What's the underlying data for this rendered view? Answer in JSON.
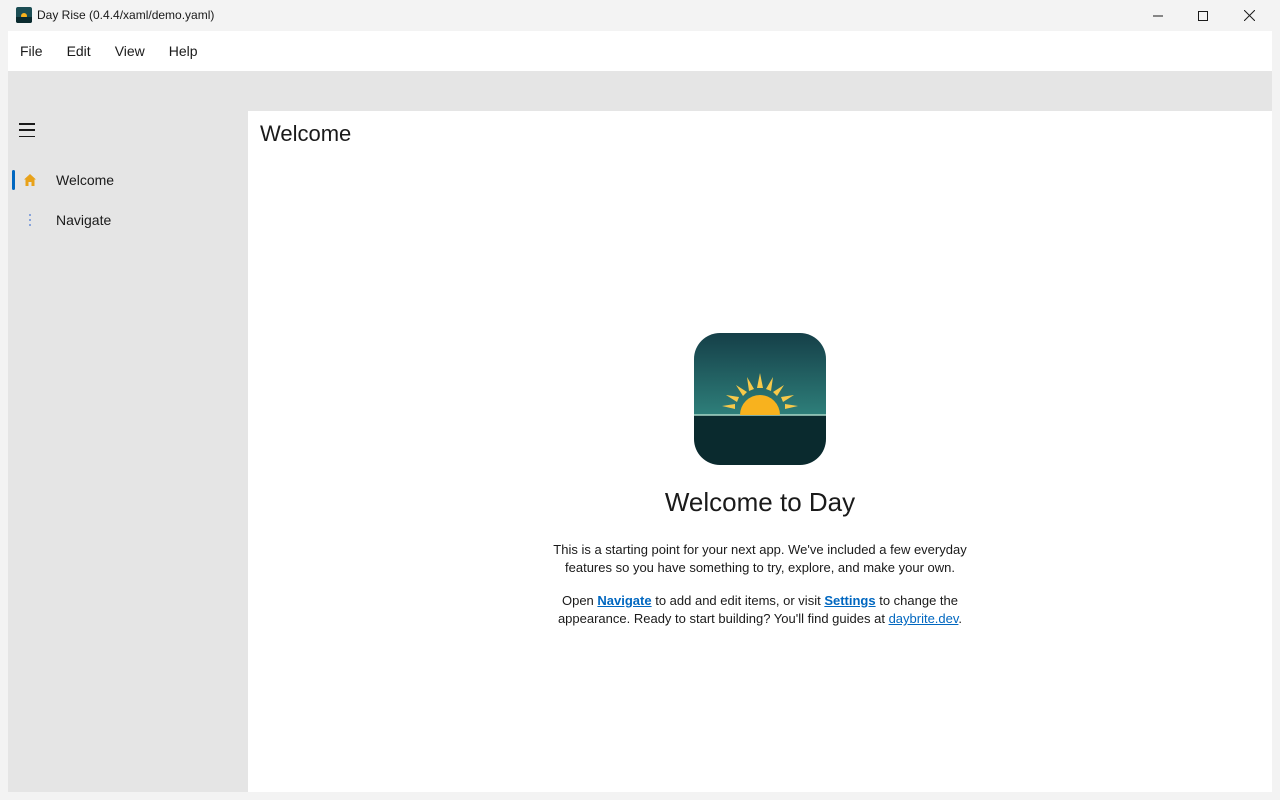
{
  "window": {
    "title": "Day Rise (0.4.4/xaml/demo.yaml)",
    "controls": {
      "minimize": "minimize-icon",
      "maximize": "maximize-icon",
      "close": "close-icon"
    }
  },
  "menu": {
    "items": [
      {
        "label": "File"
      },
      {
        "label": "Edit"
      },
      {
        "label": "View"
      },
      {
        "label": "Help"
      }
    ]
  },
  "sidebar": {
    "toggle_icon": "hamburger-icon",
    "items": [
      {
        "label": "Welcome",
        "icon": "home-icon",
        "selected": true
      },
      {
        "label": "Navigate",
        "icon": "more-vertical-icon",
        "selected": false
      }
    ]
  },
  "page": {
    "title": "Welcome",
    "heading": "Welcome to Day",
    "intro": "This is a starting point for your next app. We've included a few everyday features so you have something to try, explore, and make your own.",
    "cta_open": "Open ",
    "cta_navigate_link": "Navigate",
    "cta_mid": " to add and edit items, or visit ",
    "cta_settings_link": "Settings",
    "cta_tail": " to change the appearance. Ready to start building? You'll find guides at ",
    "cta_site_link": "daybrite.dev",
    "cta_end": "."
  },
  "colors": {
    "accent": "#0067c0",
    "home_icon": "#e8a21a",
    "logo_sky_top": "#1b4a54",
    "logo_sky_bottom": "#2e7f7a",
    "logo_sea": "#0a2a2e",
    "logo_sun": "#f8b21e"
  }
}
